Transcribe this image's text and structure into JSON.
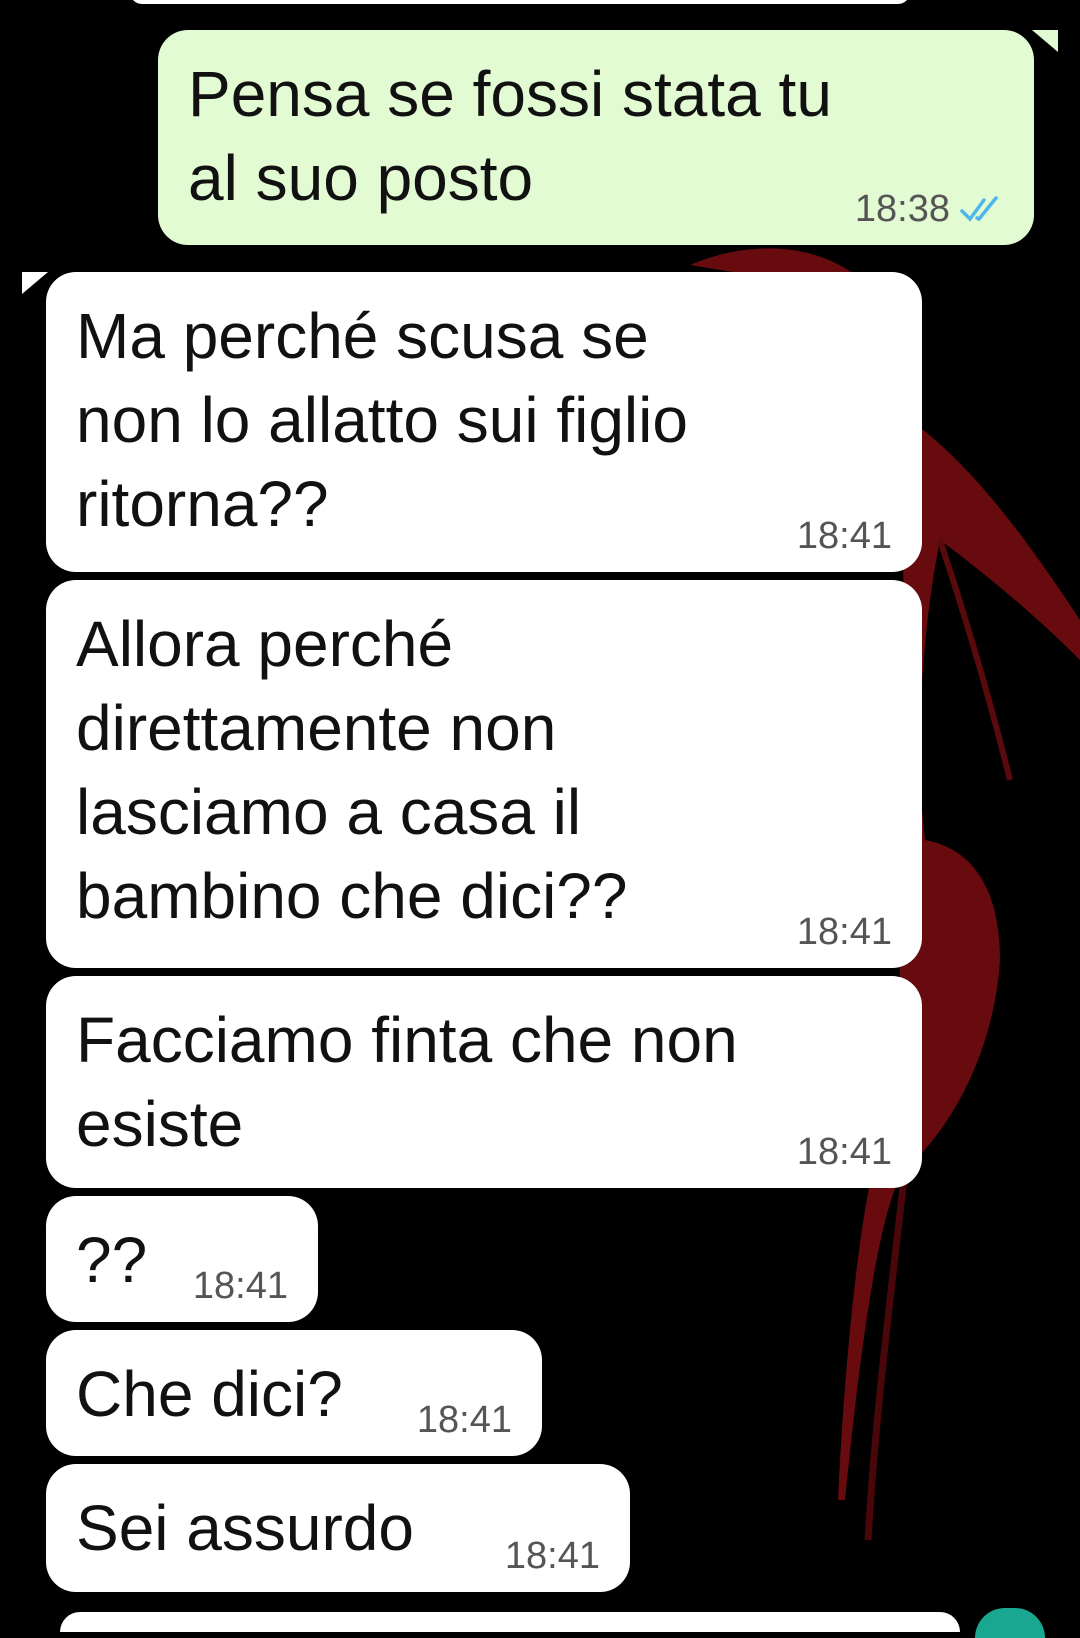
{
  "messages": [
    {
      "direction": "outgoing",
      "text": "Pensa se fossi stata tu\nal suo posto",
      "time": "18:38",
      "status": "read-double-check"
    },
    {
      "direction": "incoming",
      "text": "Ma perché scusa se\nnon lo allatto sui figlio\nritorna??",
      "time": "18:41"
    },
    {
      "direction": "incoming",
      "text": "Allora perché\ndirettamente non\nlasciamo a casa il\nbambino che dici??",
      "time": "18:41"
    },
    {
      "direction": "incoming",
      "text": "Facciamo finta che non\nesiste",
      "time": "18:41"
    },
    {
      "direction": "incoming",
      "text": "??",
      "time": "18:41"
    },
    {
      "direction": "incoming",
      "text": "Che dici?",
      "time": "18:41"
    },
    {
      "direction": "incoming",
      "text": "Sei assurdo",
      "time": "18:41"
    }
  ],
  "colors": {
    "background": "#000000",
    "outgoing_bubble": "#e2fbd3",
    "incoming_bubble": "#ffffff",
    "read_tick": "#4fb6ec",
    "wallpaper_accent": "#7a0f12"
  },
  "icons": {
    "read_receipt": "double-check-icon",
    "wallpaper": "red-bird-wallpaper"
  }
}
